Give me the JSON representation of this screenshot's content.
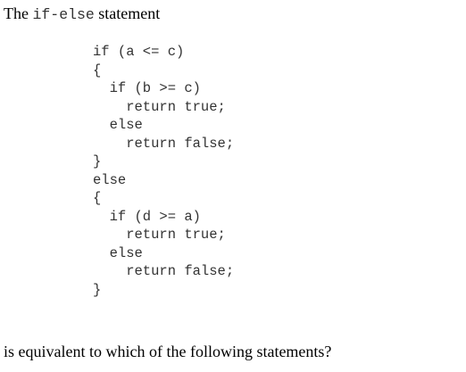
{
  "intro": {
    "prefix": "The ",
    "keyword": "if-else",
    "suffix": " statement"
  },
  "code": {
    "lines": [
      "if (a <= c)",
      "{",
      "  if (b >= c)",
      "    return true;",
      "  else",
      "    return false;",
      "}",
      "else",
      "{",
      "  if (d >= a)",
      "    return true;",
      "  else",
      "    return false;",
      "}"
    ]
  },
  "question": "is equivalent to which of the following statements?"
}
